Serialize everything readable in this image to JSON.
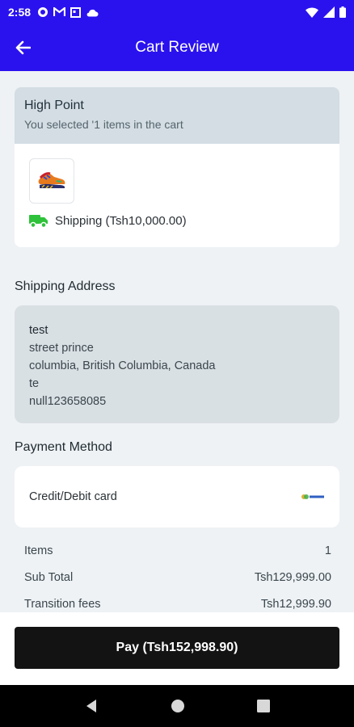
{
  "status_bar": {
    "time": "2:58"
  },
  "app_bar": {
    "title": "Cart Review"
  },
  "store": {
    "name": "High Point",
    "subtitle": "You selected '1 items in the cart",
    "shipping": "Shipping (Tsh10,000.00)"
  },
  "shipping_address": {
    "title": "Shipping Address",
    "name": "test",
    "street": "street prince",
    "city_line": "columbia, British Columbia, Canada",
    "extra": "te",
    "phone": "null123658085"
  },
  "payment_method": {
    "title": "Payment Method",
    "method": "Credit/Debit card"
  },
  "summary": [
    {
      "label": "Items",
      "value": "1"
    },
    {
      "label": "Sub Total",
      "value": "Tsh129,999.00"
    },
    {
      "label": "Transition fees",
      "value": "Tsh12,999.90"
    }
  ],
  "pay_button": {
    "label": "Pay (Tsh152,998.90)"
  },
  "colors": {
    "primary": "#2a12ef",
    "background": "#eef2f5",
    "button": "#131313",
    "truck": "#2ec23a"
  }
}
